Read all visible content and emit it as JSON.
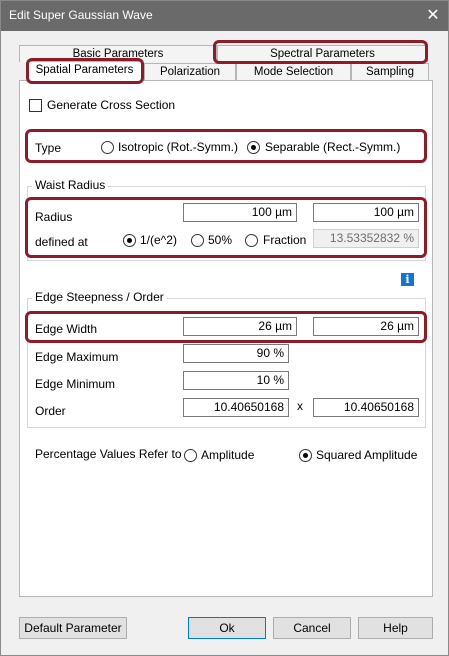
{
  "window": {
    "title": "Edit Super Gaussian Wave",
    "close_glyph": "✕"
  },
  "tabs": {
    "row_back": [
      "Basic Parameters",
      "Spectral Parameters"
    ],
    "row_front": [
      "Spatial Parameters",
      "Polarization",
      "Mode Selection",
      "Sampling"
    ],
    "active": "Spatial Parameters"
  },
  "spatial": {
    "generate_cross_section": {
      "label": "Generate Cross Section",
      "checked": false
    },
    "type": {
      "label": "Type",
      "options": [
        "Isotropic (Rot.-Symm.)",
        "Separable (Rect.-Symm.)"
      ],
      "selected": "Separable (Rect.-Symm.)"
    },
    "waist_radius": {
      "group_title": "Waist Radius",
      "radius_label": "Radius",
      "radius_x": "100 µm",
      "radius_y": "100 µm",
      "defined_at_label": "defined at",
      "defined_at_options": [
        "1/(e^2)",
        "50%",
        "Fraction"
      ],
      "defined_at_selected": "1/(e^2)",
      "fraction_value": "13.53352832 %"
    },
    "edge": {
      "group_title": "Edge Steepness / Order",
      "edge_width_label": "Edge Width",
      "edge_width_x": "26 µm",
      "edge_width_y": "26 µm",
      "edge_max_label": "Edge Maximum",
      "edge_max": "90 %",
      "edge_min_label": "Edge Minimum",
      "edge_min": "10 %",
      "order_label": "Order",
      "order_x": "10.40650168",
      "order_sep": "x",
      "order_y": "10.40650168"
    },
    "percentage": {
      "label": "Percentage Values Refer to",
      "options": [
        "Amplitude",
        "Squared Amplitude"
      ],
      "selected": "Squared Amplitude"
    },
    "info_icon": "info-icon"
  },
  "buttons": {
    "default_param": "Default Parameter",
    "ok": "Ok",
    "cancel": "Cancel",
    "help": "Help"
  },
  "colors": {
    "highlight": "#8c1c2a",
    "titlebar": "#6a6a6a",
    "info": "#1573d1"
  }
}
